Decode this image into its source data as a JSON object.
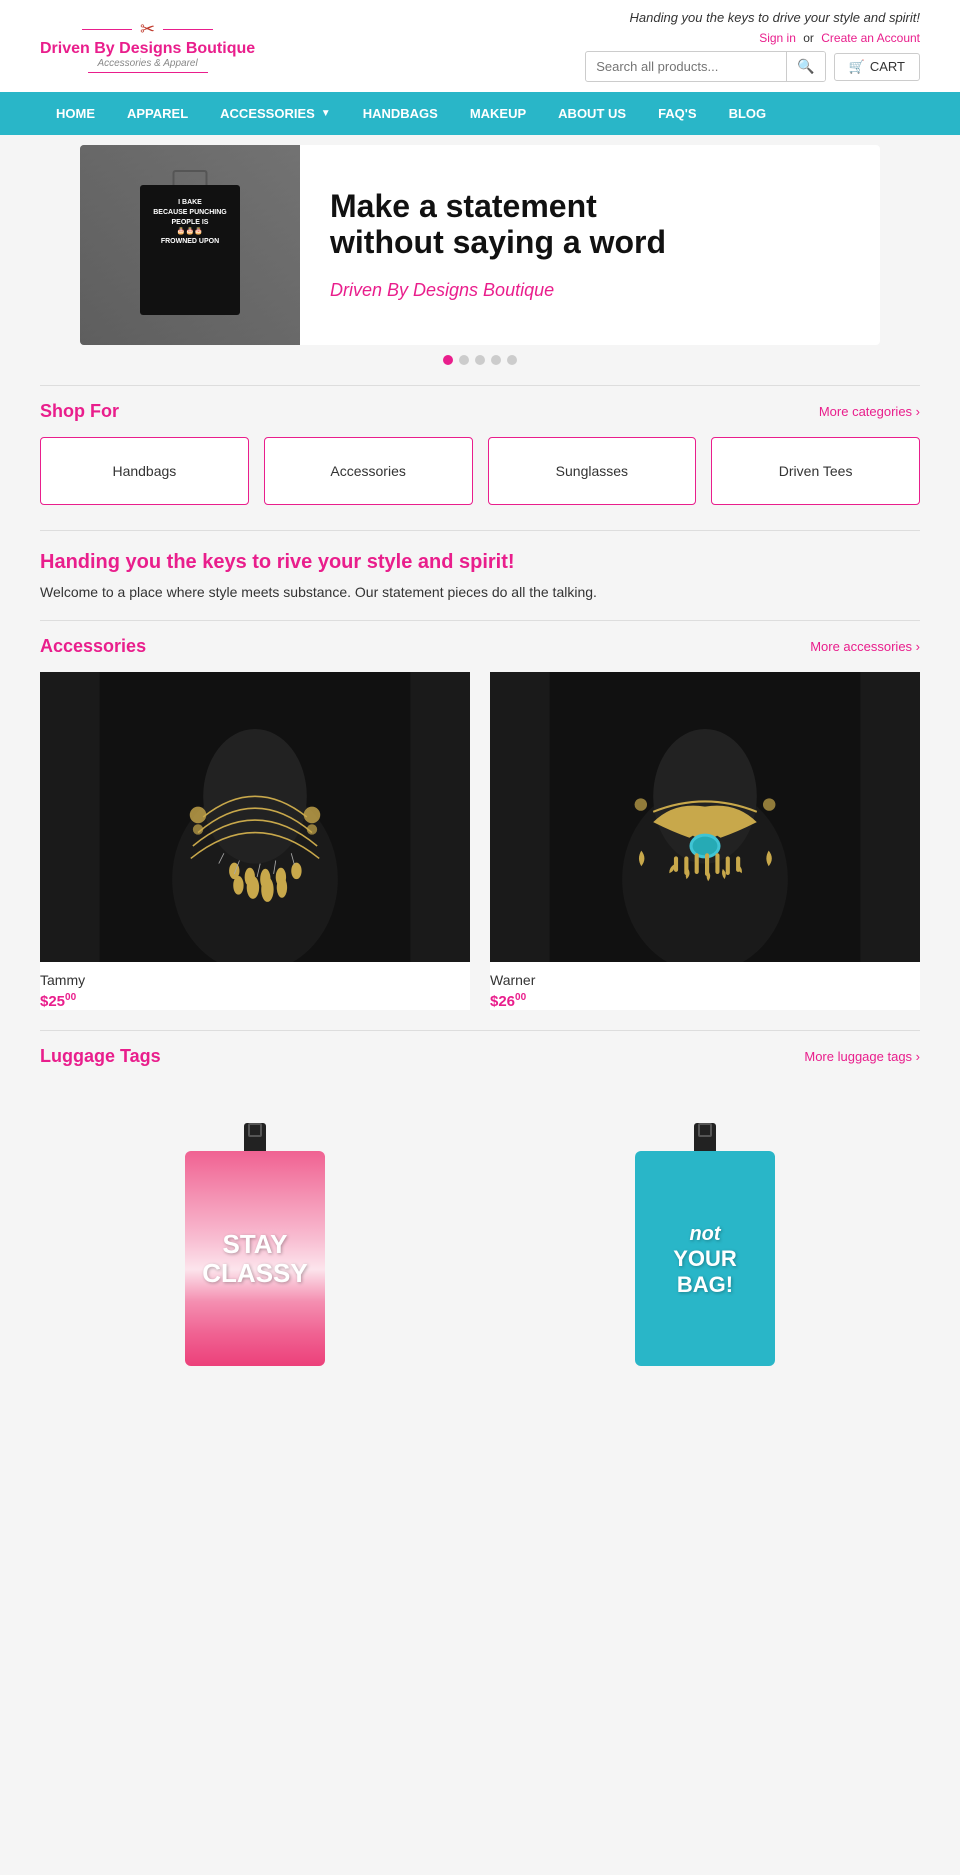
{
  "site": {
    "tagline": "Handing you the keys to drive your style and spirit!",
    "tagline_italic": true
  },
  "header": {
    "auth": {
      "signin_label": "Sign in",
      "or_text": "or",
      "create_account_label": "Create an Account"
    },
    "logo": {
      "scissors_icon": "✂",
      "title": "Driven By Designs Boutique",
      "subtitle": "Accessories & Apparel"
    },
    "search": {
      "placeholder": "Search all products...",
      "button_icon": "🔍"
    },
    "cart": {
      "icon": "🛒",
      "label": "CART"
    }
  },
  "nav": {
    "items": [
      {
        "label": "HOME",
        "has_dropdown": false
      },
      {
        "label": "APPAREL",
        "has_dropdown": false
      },
      {
        "label": "ACCESSORIES",
        "has_dropdown": true
      },
      {
        "label": "HANDBAGS",
        "has_dropdown": false
      },
      {
        "label": "MAKEUP",
        "has_dropdown": false
      },
      {
        "label": "ABOUT US",
        "has_dropdown": false
      },
      {
        "label": "FAQ'S",
        "has_dropdown": false
      },
      {
        "label": "BLOG",
        "has_dropdown": false
      }
    ]
  },
  "hero": {
    "headline_line1": "Make a statement",
    "headline_line2": "without saying a word",
    "brand": "Driven By Designs Boutique",
    "bag_text": "I BAKE\nBECAUSE PUNCHING\nPEOPLE IS\nFROWNED UPON",
    "dots": [
      true,
      false,
      false,
      false,
      false
    ]
  },
  "shop_for": {
    "title": "Shop For",
    "more_link": "More categories ›",
    "categories": [
      {
        "label": "Handbags"
      },
      {
        "label": "Accessories"
      },
      {
        "label": "Sunglasses"
      },
      {
        "label": "Driven Tees"
      }
    ]
  },
  "tagline_section": {
    "title": "Handing you the keys to rive your style and spirit!",
    "description": "Welcome to a place where style meets substance. Our statement pieces do all the talking."
  },
  "accessories": {
    "title": "Accessories",
    "more_link": "More accessories ›",
    "products": [
      {
        "name": "Tammy",
        "price_dollars": "25",
        "price_cents": "00"
      },
      {
        "name": "Warner",
        "price_dollars": "26",
        "price_cents": "00"
      }
    ]
  },
  "luggage_tags": {
    "title": "Luggage Tags",
    "more_link": "More luggage tags ›",
    "items": [
      {
        "text_line1": "STAY",
        "text_line2": "CLASSY",
        "color": "pink"
      },
      {
        "text_line1": "not",
        "text_line2": "YOUR",
        "text_line3": "BAG!",
        "color": "blue"
      }
    ]
  }
}
